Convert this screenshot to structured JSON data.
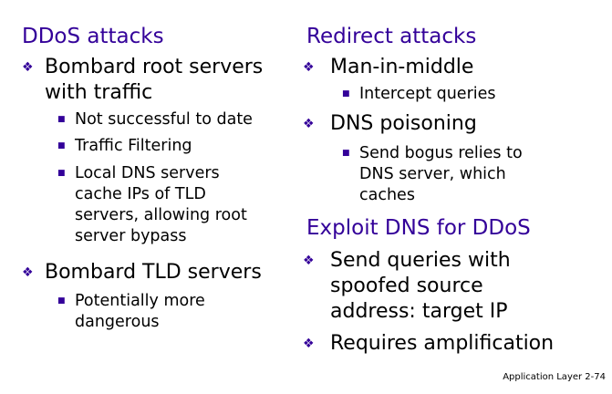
{
  "colors": {
    "heading": "#330099",
    "bullet_glyph": "#330099",
    "text": "#000000",
    "background": "#ffffff"
  },
  "icons": {
    "level1": "diamond-bullet-icon",
    "level2": "square-bullet-icon"
  },
  "left": {
    "heading": "DDoS attacks",
    "item1": {
      "line1": "Bombard root servers",
      "line2": "with traffic",
      "sub1": "Not successful to date",
      "sub2": "Traffic Filtering",
      "sub3_line1": "Local DNS servers",
      "sub3_line2": "cache IPs of TLD",
      "sub3_line3": "servers, allowing root",
      "sub3_line4": "server bypass"
    },
    "item2": {
      "line1": "Bombard TLD servers",
      "sub1_line1": "Potentially more",
      "sub1_line2": "dangerous"
    }
  },
  "right": {
    "heading1": "Redirect attacks",
    "item1": {
      "line1": "Man-in-middle",
      "sub1": "Intercept queries"
    },
    "item2": {
      "line1": "DNS poisoning",
      "sub1_line1": "Send bogus relies to",
      "sub1_line2": "DNS server, which",
      "sub1_line3": "caches"
    },
    "heading2": "Exploit DNS for DDoS",
    "item3": {
      "line1": "Send queries with",
      "line2": "spoofed source",
      "line3": "address: target IP"
    },
    "item4": {
      "line1": "Requires amplification"
    }
  },
  "footer": "Application Layer 2-74"
}
